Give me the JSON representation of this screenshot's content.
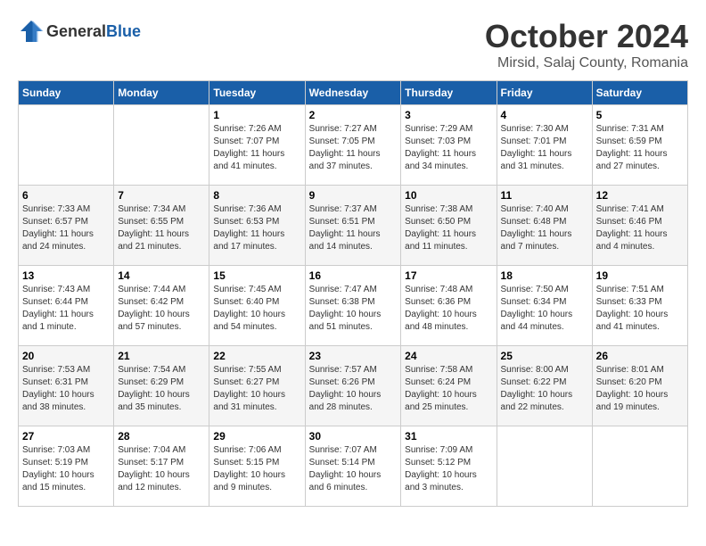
{
  "header": {
    "logo_general": "General",
    "logo_blue": "Blue",
    "month": "October 2024",
    "location": "Mirsid, Salaj County, Romania"
  },
  "days_of_week": [
    "Sunday",
    "Monday",
    "Tuesday",
    "Wednesday",
    "Thursday",
    "Friday",
    "Saturday"
  ],
  "weeks": [
    [
      {
        "day": "",
        "details": ""
      },
      {
        "day": "",
        "details": ""
      },
      {
        "day": "1",
        "details": "Sunrise: 7:26 AM\nSunset: 7:07 PM\nDaylight: 11 hours and 41 minutes."
      },
      {
        "day": "2",
        "details": "Sunrise: 7:27 AM\nSunset: 7:05 PM\nDaylight: 11 hours and 37 minutes."
      },
      {
        "day": "3",
        "details": "Sunrise: 7:29 AM\nSunset: 7:03 PM\nDaylight: 11 hours and 34 minutes."
      },
      {
        "day": "4",
        "details": "Sunrise: 7:30 AM\nSunset: 7:01 PM\nDaylight: 11 hours and 31 minutes."
      },
      {
        "day": "5",
        "details": "Sunrise: 7:31 AM\nSunset: 6:59 PM\nDaylight: 11 hours and 27 minutes."
      }
    ],
    [
      {
        "day": "6",
        "details": "Sunrise: 7:33 AM\nSunset: 6:57 PM\nDaylight: 11 hours and 24 minutes."
      },
      {
        "day": "7",
        "details": "Sunrise: 7:34 AM\nSunset: 6:55 PM\nDaylight: 11 hours and 21 minutes."
      },
      {
        "day": "8",
        "details": "Sunrise: 7:36 AM\nSunset: 6:53 PM\nDaylight: 11 hours and 17 minutes."
      },
      {
        "day": "9",
        "details": "Sunrise: 7:37 AM\nSunset: 6:51 PM\nDaylight: 11 hours and 14 minutes."
      },
      {
        "day": "10",
        "details": "Sunrise: 7:38 AM\nSunset: 6:50 PM\nDaylight: 11 hours and 11 minutes."
      },
      {
        "day": "11",
        "details": "Sunrise: 7:40 AM\nSunset: 6:48 PM\nDaylight: 11 hours and 7 minutes."
      },
      {
        "day": "12",
        "details": "Sunrise: 7:41 AM\nSunset: 6:46 PM\nDaylight: 11 hours and 4 minutes."
      }
    ],
    [
      {
        "day": "13",
        "details": "Sunrise: 7:43 AM\nSunset: 6:44 PM\nDaylight: 11 hours and 1 minute."
      },
      {
        "day": "14",
        "details": "Sunrise: 7:44 AM\nSunset: 6:42 PM\nDaylight: 10 hours and 57 minutes."
      },
      {
        "day": "15",
        "details": "Sunrise: 7:45 AM\nSunset: 6:40 PM\nDaylight: 10 hours and 54 minutes."
      },
      {
        "day": "16",
        "details": "Sunrise: 7:47 AM\nSunset: 6:38 PM\nDaylight: 10 hours and 51 minutes."
      },
      {
        "day": "17",
        "details": "Sunrise: 7:48 AM\nSunset: 6:36 PM\nDaylight: 10 hours and 48 minutes."
      },
      {
        "day": "18",
        "details": "Sunrise: 7:50 AM\nSunset: 6:34 PM\nDaylight: 10 hours and 44 minutes."
      },
      {
        "day": "19",
        "details": "Sunrise: 7:51 AM\nSunset: 6:33 PM\nDaylight: 10 hours and 41 minutes."
      }
    ],
    [
      {
        "day": "20",
        "details": "Sunrise: 7:53 AM\nSunset: 6:31 PM\nDaylight: 10 hours and 38 minutes."
      },
      {
        "day": "21",
        "details": "Sunrise: 7:54 AM\nSunset: 6:29 PM\nDaylight: 10 hours and 35 minutes."
      },
      {
        "day": "22",
        "details": "Sunrise: 7:55 AM\nSunset: 6:27 PM\nDaylight: 10 hours and 31 minutes."
      },
      {
        "day": "23",
        "details": "Sunrise: 7:57 AM\nSunset: 6:26 PM\nDaylight: 10 hours and 28 minutes."
      },
      {
        "day": "24",
        "details": "Sunrise: 7:58 AM\nSunset: 6:24 PM\nDaylight: 10 hours and 25 minutes."
      },
      {
        "day": "25",
        "details": "Sunrise: 8:00 AM\nSunset: 6:22 PM\nDaylight: 10 hours and 22 minutes."
      },
      {
        "day": "26",
        "details": "Sunrise: 8:01 AM\nSunset: 6:20 PM\nDaylight: 10 hours and 19 minutes."
      }
    ],
    [
      {
        "day": "27",
        "details": "Sunrise: 7:03 AM\nSunset: 5:19 PM\nDaylight: 10 hours and 15 minutes."
      },
      {
        "day": "28",
        "details": "Sunrise: 7:04 AM\nSunset: 5:17 PM\nDaylight: 10 hours and 12 minutes."
      },
      {
        "day": "29",
        "details": "Sunrise: 7:06 AM\nSunset: 5:15 PM\nDaylight: 10 hours and 9 minutes."
      },
      {
        "day": "30",
        "details": "Sunrise: 7:07 AM\nSunset: 5:14 PM\nDaylight: 10 hours and 6 minutes."
      },
      {
        "day": "31",
        "details": "Sunrise: 7:09 AM\nSunset: 5:12 PM\nDaylight: 10 hours and 3 minutes."
      },
      {
        "day": "",
        "details": ""
      },
      {
        "day": "",
        "details": ""
      }
    ]
  ]
}
